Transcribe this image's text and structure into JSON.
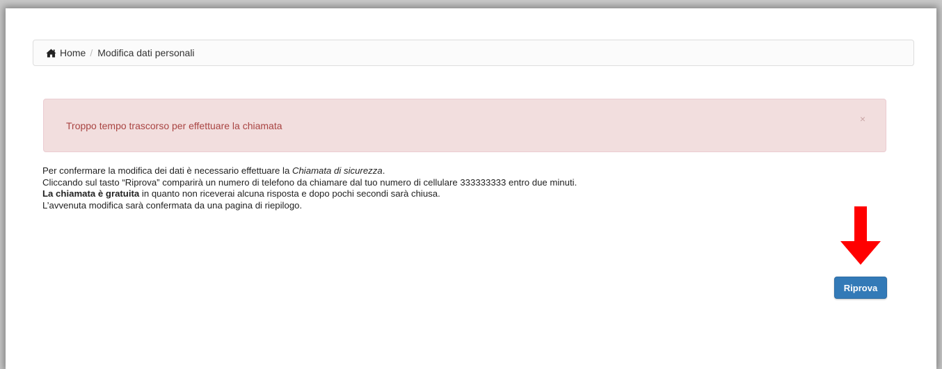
{
  "breadcrumb": {
    "home_label": "Home",
    "separator": "/",
    "current": "Modifica dati personali"
  },
  "alert": {
    "message": "Troppo tempo trascorso per effettuare la chiamata",
    "close_symbol": "×",
    "background_color": "#f2dede",
    "text_color": "#a94442"
  },
  "info": {
    "line1_prefix": "Per confermare la modifica dei dati è necessario effettuare la ",
    "line1_emphasis": "Chiamata di sicurezza",
    "line1_suffix": ".",
    "line2": "Cliccando sul tasto “Riprova” comparirà un numero di telefono da chiamare dal tuo numero di cellulare 333333333 entro due minuti.",
    "line3_bold": "La chiamata è gratuita",
    "line3_rest": " in quanto non riceverai alcuna risposta e dopo pochi secondi sarà chiusa.",
    "line4": "L’avvenuta modifica sarà confermata da una pagina di riepilogo."
  },
  "annotation": {
    "icon": "arrow-down-icon",
    "color": "#ff0000"
  },
  "retry_button": {
    "label": "Riprova",
    "color": "#337ab7"
  }
}
